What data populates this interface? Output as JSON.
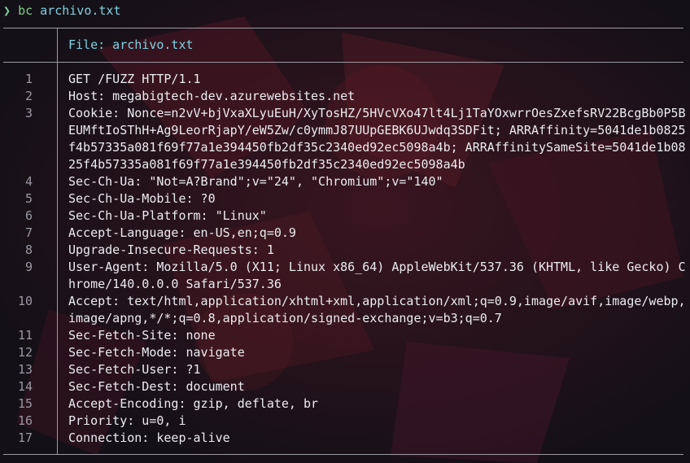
{
  "colors": {
    "background": "#141017",
    "accent_red": "#5a1a24",
    "prompt_green": "#7fd1a0",
    "header_cyan": "#7fd1e0",
    "line_number": "#9a98a4",
    "text": "#ececf0",
    "rule": "#9b9aa3"
  },
  "prompt": {
    "arrow": "❯",
    "command": "bc",
    "argument": "archivo.txt"
  },
  "viewer": {
    "header": "File: archivo.txt",
    "lines": [
      {
        "n": "1",
        "text": "GET /FUZZ HTTP/1.1"
      },
      {
        "n": "2",
        "text": "Host: megabigtech-dev.azurewebsites.net"
      },
      {
        "n": "3",
        "text": "Cookie: Nonce=n2vV+bjVxaXLyuEuH/XyTosHZ/5HVcVXo47lt4Lj1TaYOxwrrOesZxefsRV22BcgBb0P5BEUMftIoSThH+Ag9LeorRjapY/eW5Zw/c0ymmJ87UUpGEBK6UJwdq3SDFit; ARRAffinity=5041de1b0825f4b57335a081f69f77a1e394450fb2df35c2340ed92ec5098a4b; ARRAffinitySameSite=5041de1b0825f4b57335a081f69f77a1e394450fb2df35c2340ed92ec5098a4b"
      },
      {
        "n": "4",
        "text": "Sec-Ch-Ua: \"Not=A?Brand\";v=\"24\", \"Chromium\";v=\"140\""
      },
      {
        "n": "5",
        "text": "Sec-Ch-Ua-Mobile: ?0"
      },
      {
        "n": "6",
        "text": "Sec-Ch-Ua-Platform: \"Linux\""
      },
      {
        "n": "7",
        "text": "Accept-Language: en-US,en;q=0.9"
      },
      {
        "n": "8",
        "text": "Upgrade-Insecure-Requests: 1"
      },
      {
        "n": "9",
        "text": "User-Agent: Mozilla/5.0 (X11; Linux x86_64) AppleWebKit/537.36 (KHTML, like Gecko) Chrome/140.0.0.0 Safari/537.36"
      },
      {
        "n": "10",
        "text": "Accept: text/html,application/xhtml+xml,application/xml;q=0.9,image/avif,image/webp,image/apng,*/*;q=0.8,application/signed-exchange;v=b3;q=0.7"
      },
      {
        "n": "11",
        "text": "Sec-Fetch-Site: none"
      },
      {
        "n": "12",
        "text": "Sec-Fetch-Mode: navigate"
      },
      {
        "n": "13",
        "text": "Sec-Fetch-User: ?1"
      },
      {
        "n": "14",
        "text": "Sec-Fetch-Dest: document"
      },
      {
        "n": "15",
        "text": "Accept-Encoding: gzip, deflate, br"
      },
      {
        "n": "16",
        "text": "Priority: u=0, i"
      },
      {
        "n": "17",
        "text": "Connection: keep-alive"
      }
    ]
  }
}
